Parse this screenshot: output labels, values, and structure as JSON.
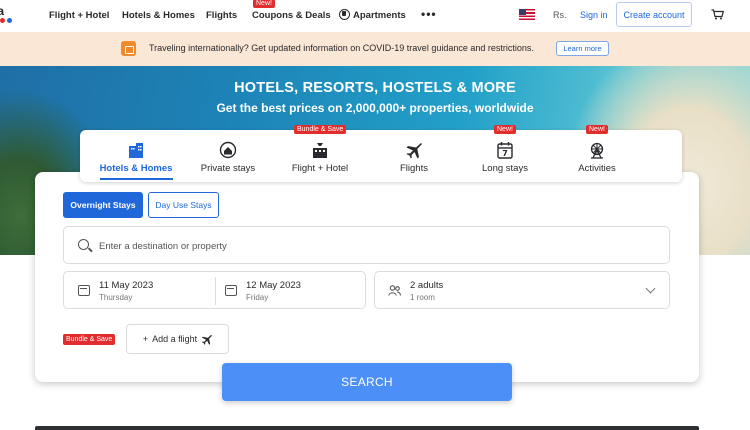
{
  "nav": {
    "logo_text": "da",
    "logo_colors": [
      "#e12d2d",
      "#f4a623",
      "#2067da",
      "#8b3fb8"
    ],
    "items": [
      {
        "label": "Flight + Hotel"
      },
      {
        "label": "Hotels & Homes"
      },
      {
        "label": "Flights"
      },
      {
        "label": "Coupons & Deals",
        "badge": "New!"
      },
      {
        "label": "Apartments"
      }
    ],
    "more_icon": "more-horizontal-icon",
    "currency": "Rs.",
    "signin": "Sign in",
    "create_account": "Create account",
    "cart_icon": "cart-icon"
  },
  "banner": {
    "text": "Traveling internationally? Get updated information on COVID-19 travel guidance and restrictions.",
    "learn_more": "Learn more"
  },
  "hero": {
    "title": "HOTELS, RESORTS, HOSTELS & MORE",
    "subtitle": "Get the best prices on 2,000,000+ properties, worldwide"
  },
  "tabs": [
    {
      "label": "Hotels & Homes",
      "icon": "hotel-icon",
      "active": true
    },
    {
      "label": "Private stays",
      "icon": "private-stay-icon"
    },
    {
      "label": "Flight + Hotel",
      "icon": "flight-hotel-icon",
      "badge": "Bundle & Save"
    },
    {
      "label": "Flights",
      "icon": "airplane-icon"
    },
    {
      "label": "Long stays",
      "icon": "calendar-7-icon",
      "badge": "New!"
    },
    {
      "label": "Activities",
      "icon": "ferris-wheel-icon",
      "badge": "New!"
    }
  ],
  "search": {
    "overnight": "Overnight Stays",
    "dayuse": "Day Use Stays",
    "destination_placeholder": "Enter a destination or property",
    "checkin_date": "11 May 2023",
    "checkin_day": "Thursday",
    "checkout_date": "12 May 2023",
    "checkout_day": "Friday",
    "guests": "2 adults",
    "rooms": "1 room",
    "bundle_badge": "Bundle & Save",
    "add_flight": "Add a flight",
    "button": "SEARCH"
  },
  "colors": {
    "accent": "#2067da",
    "badge": "#e12d2d",
    "banner_bg": "#fbe7d6",
    "search_button": "#4c8ff7"
  }
}
